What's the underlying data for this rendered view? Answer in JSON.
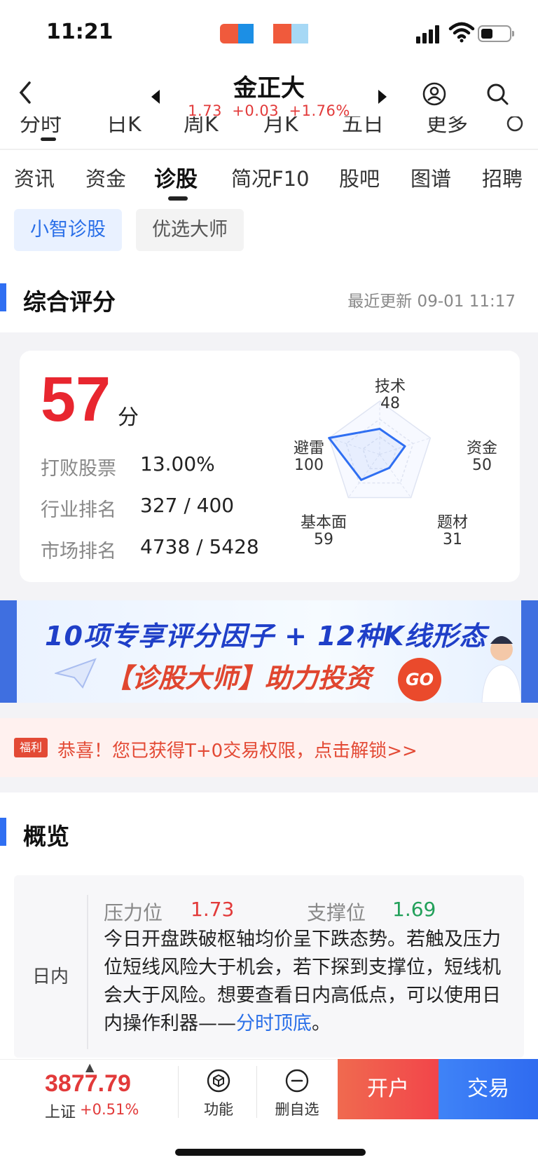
{
  "status": {
    "time": "11:21"
  },
  "nav": {
    "stock_name": "金正大",
    "price": "1.73",
    "change": "+0.03",
    "change_pct": "+1.76%"
  },
  "period_tabs": [
    "分时",
    "日K",
    "周K",
    "月K",
    "五日",
    "更多"
  ],
  "tabs": [
    "资讯",
    "资金",
    "诊股",
    "简况F10",
    "股吧",
    "图谱",
    "招聘"
  ],
  "active_tab": "诊股",
  "chips": [
    "小智诊股",
    "优选大师"
  ],
  "rating": {
    "title": "综合评分",
    "update": "最近更新 09-01 11:17",
    "score": "57",
    "score_unit": "分",
    "stats": [
      {
        "label": "打败股票",
        "value": "13.00%"
      },
      {
        "label": "行业排名",
        "value": "327 / 400"
      },
      {
        "label": "市场排名",
        "value": "4738 / 5428"
      }
    ],
    "radar": [
      {
        "name": "技术",
        "value": 48
      },
      {
        "name": "资金",
        "value": 50
      },
      {
        "name": "题材",
        "value": 31
      },
      {
        "name": "基本面",
        "value": 59
      },
      {
        "name": "避雷",
        "value": 100
      }
    ],
    "radar_color": "#2f6ff2"
  },
  "banner": {
    "line1": "10项专享评分因子 + 12种K线形态",
    "line2": "【诊股大师】助力投资",
    "go": "GO"
  },
  "promo": {
    "badge": "福利",
    "text": "恭喜！您已获得T+0交易权限，点击解锁>>"
  },
  "overview": {
    "title": "概览",
    "row_label": "日内",
    "pressure_label": "压力位",
    "pressure_value": "1.73",
    "support_label": "支撑位",
    "support_value": "1.69",
    "desc": "今日开盘跌破枢轴均价呈下跌态势。若触及压力位短线风险大于机会，若下探到支撑位，短线机会大于风险。想要查看日内高低点，可以使用日内操作利器——",
    "link": "分时顶底",
    "desc_end": "。"
  },
  "bottom": {
    "index_value": "3877.79",
    "index_name": "上证",
    "index_change": "+0.51%",
    "func_label": "功能",
    "remove_label": "删自选",
    "open_label": "开户",
    "trade_label": "交易"
  }
}
